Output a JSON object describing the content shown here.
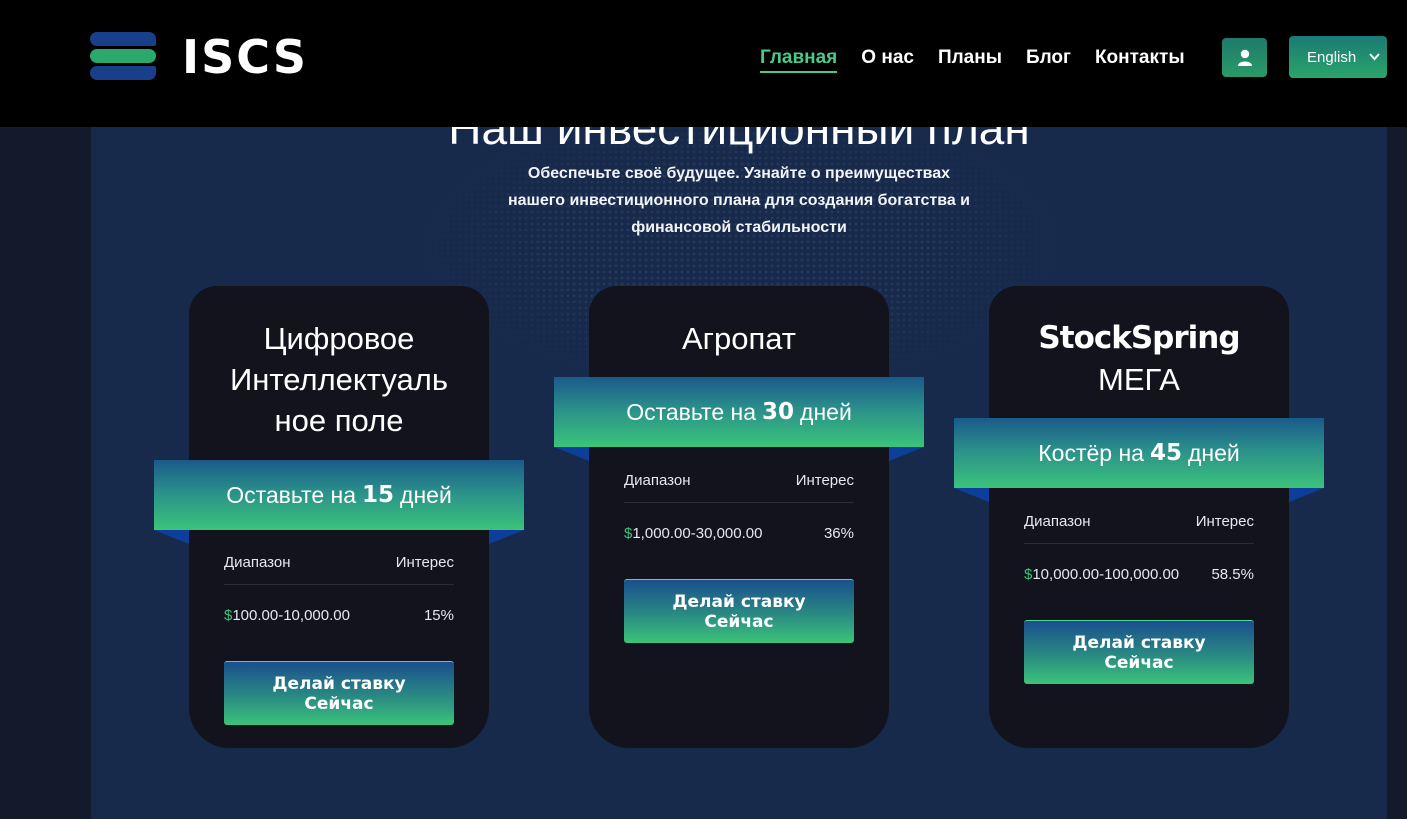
{
  "header": {
    "logo_text": "ISCS",
    "nav": [
      {
        "label": "Главная",
        "active": true
      },
      {
        "label": "О нас",
        "active": false
      },
      {
        "label": "Планы",
        "active": false
      },
      {
        "label": "Блог",
        "active": false
      },
      {
        "label": "Контакты",
        "active": false
      }
    ],
    "user_icon": "user-icon",
    "language": {
      "selected": "English"
    }
  },
  "section": {
    "title": "Наш инвестиционный план",
    "subtitle_lines": [
      "Обеспечьте своё будущее. Узнайте о преимуществах",
      "нашего инвестиционного плана для создания богатства и",
      "финансовой стабильности"
    ]
  },
  "plans": [
    {
      "title_lines": [
        "Цифровое",
        "Интеллектуаль",
        "ное поле"
      ],
      "ribbon_prefix": "Оставьте на",
      "ribbon_days": "15",
      "ribbon_suffix": "дней",
      "range_label": "Диапазон",
      "interest_label": "Интерес",
      "currency": "$",
      "range": "100.00-10,000.00",
      "interest": "15%",
      "button_lines": [
        "Делай ставку",
        "Сейчас"
      ]
    },
    {
      "title_lines": [
        "Агропат"
      ],
      "ribbon_prefix": "Оставьте на",
      "ribbon_days": "30",
      "ribbon_suffix": "дней",
      "range_label": "Диапазон",
      "interest_label": "Интерес",
      "currency": "$",
      "range": "1,000.00-30,000.00",
      "interest": "36%",
      "button_lines": [
        "Делай ставку",
        "Сейчас"
      ]
    },
    {
      "title_lines": [
        "StockSpring",
        "МЕГА"
      ],
      "ribbon_prefix": "Костёр на",
      "ribbon_days": "45",
      "ribbon_suffix": "дней",
      "range_label": "Диапазон",
      "interest_label": "Интерес",
      "currency": "$",
      "range": "10,000.00-100,000.00",
      "interest": "58.5%",
      "button_lines": [
        "Делай ставку",
        "Сейчас"
      ]
    }
  ],
  "colors": {
    "accent_green": "#49c98a",
    "deep_blue": "#0d3f9a",
    "card_bg": "#12131c",
    "section_bg": "#172a4c"
  }
}
